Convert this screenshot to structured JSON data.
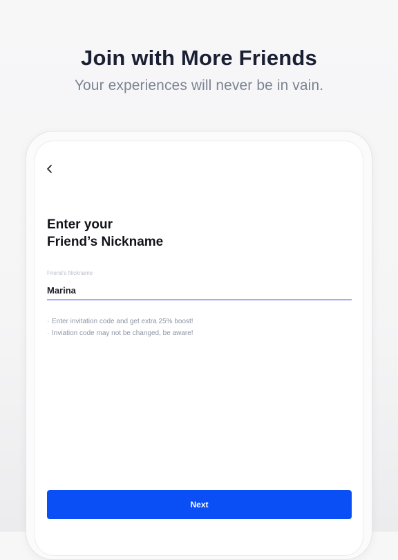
{
  "marketing": {
    "headline": "Join with More Friends",
    "subhead": "Your experiences will never be in vain."
  },
  "screen": {
    "back_icon": "chevron-left-icon",
    "title_line1": "Enter your",
    "title_line2": "Friend’s Nickname",
    "field": {
      "label": "Friend’s Nickname",
      "value": "Marina"
    },
    "hints": [
      "Enter invitation code and get extra 25% boost!",
      "Inviation code may not be changed, be aware!"
    ],
    "next_label": "Next"
  },
  "colors": {
    "primary": "#0a4ff5",
    "input_underline": "#9fb0f0",
    "headline": "#1b1f33",
    "subhead": "#7c8493"
  }
}
